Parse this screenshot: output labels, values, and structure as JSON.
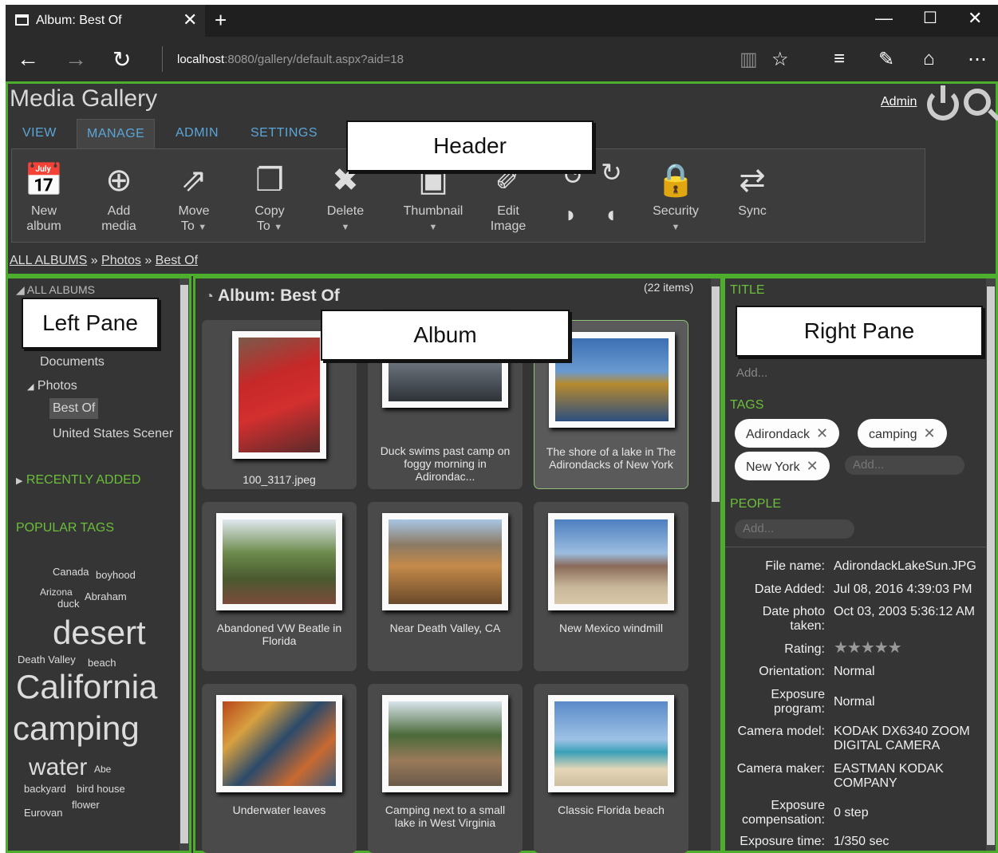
{
  "browser": {
    "tab_title": "Album: Best Of",
    "url_host": "localhost",
    "url_path": ":8080/gallery/default.aspx?aid=18"
  },
  "header": {
    "title": "Media Gallery",
    "admin_link": "Admin",
    "tabs": [
      "VIEW",
      "MANAGE",
      "ADMIN",
      "SETTINGS"
    ],
    "ribbon": [
      {
        "l1": "New",
        "l2": "album",
        "icon": "calendar-add-icon"
      },
      {
        "l1": "Add",
        "l2": "media",
        "icon": "plus-circle-icon"
      },
      {
        "l1": "Move",
        "l2": "To",
        "icon": "move-icon"
      },
      {
        "l1": "Copy",
        "l2": "To",
        "icon": "copy-icon"
      },
      {
        "l1": "Delete",
        "l2": "",
        "icon": "delete-icon"
      },
      {
        "l1": "Thumbnail",
        "l2": "",
        "icon": "thumbnail-icon"
      },
      {
        "l1": "Edit",
        "l2": "Image",
        "icon": "edit-image-icon"
      },
      {
        "l1": "Security",
        "l2": "",
        "icon": "lock-icon"
      },
      {
        "l1": "Sync",
        "l2": "",
        "icon": "sync-icon"
      }
    ],
    "breadcrumb": [
      "ALL ALBUMS",
      "Photos",
      "Best Of"
    ],
    "breadcrumb_sep": "»"
  },
  "left": {
    "all_albums": "ALL ALBUMS",
    "items": [
      "Documents",
      "Photos",
      "Best Of",
      "United States Scener"
    ],
    "recently_added": "RECENTLY ADDED",
    "popular_tags": "POPULAR TAGS",
    "tags": [
      "Canada",
      "boyhood",
      "Arizona",
      "Abraham",
      "duck",
      "desert",
      "Death Valley",
      "beach",
      "California",
      "camping",
      "water",
      "Abe",
      "backyard",
      "bird house",
      "Eurovan",
      "flower"
    ]
  },
  "album": {
    "title": "Album: Best Of",
    "count": "(22 items)",
    "items": [
      {
        "caption": "100_3117.jpeg"
      },
      {
        "caption": "Duck swims past camp on foggy morning in Adirondac..."
      },
      {
        "caption": "The shore of a lake in The Adirondacks of New York"
      },
      {
        "caption": "Abandoned VW Beatle in Florida"
      },
      {
        "caption": "Near Death Valley, CA"
      },
      {
        "caption": "New Mexico windmill"
      },
      {
        "caption": "Underwater leaves"
      },
      {
        "caption": "Camping next to a small lake in West Virginia"
      },
      {
        "caption": "Classic Florida beach"
      }
    ]
  },
  "right": {
    "title_label": "TITLE",
    "caption_add": "Add...",
    "tags_label": "TAGS",
    "tags": [
      "Adirondack",
      "camping",
      "New York"
    ],
    "tag_add": "Add...",
    "people_label": "PEOPLE",
    "people_add": "Add...",
    "stars": "★★★★★",
    "props": [
      {
        "k": "File name:",
        "v": "AdirondackLakeSun.JPG"
      },
      {
        "k": "Date Added:",
        "v": "Jul 08, 2016 4:39:03 PM"
      },
      {
        "k": "Date photo taken:",
        "v": "Oct 03, 2003 5:36:12 AM"
      },
      {
        "k": "Rating:",
        "v": ""
      },
      {
        "k": "Orientation:",
        "v": "Normal"
      },
      {
        "k": "Exposure program:",
        "v": "Normal"
      },
      {
        "k": "Camera model:",
        "v": "KODAK DX6340 ZOOM DIGITAL CAMERA"
      },
      {
        "k": "Camera maker:",
        "v": "EASTMAN KODAK COMPANY"
      },
      {
        "k": "Exposure compensation:",
        "v": "0 step"
      },
      {
        "k": "Exposure time:",
        "v": "1/350 sec"
      }
    ]
  },
  "annotations": [
    "Header",
    "Left Pane",
    "Album",
    "Right Pane"
  ]
}
